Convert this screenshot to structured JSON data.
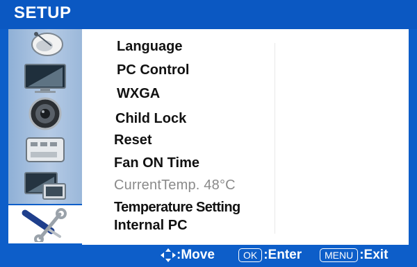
{
  "header": {
    "title": "SETUP"
  },
  "sidebar": {
    "icons": [
      {
        "name": "satellite-dish-icon"
      },
      {
        "name": "tv-screen-icon"
      },
      {
        "name": "speaker-icon"
      },
      {
        "name": "adapter-card-icon"
      },
      {
        "name": "pc-display-icon"
      },
      {
        "name": "setup-tools-icon"
      }
    ],
    "active_index": 5
  },
  "menu": {
    "items": [
      {
        "label": "Language"
      },
      {
        "label": "PC Control"
      },
      {
        "label": "WXGA"
      },
      {
        "label": "Child Lock"
      },
      {
        "label": "Reset"
      },
      {
        "label": "Fan ON Time"
      },
      {
        "label": "CurrentTemp. 48°C"
      },
      {
        "label": "Temperature Setting"
      },
      {
        "label": "Internal PC"
      }
    ]
  },
  "footer": {
    "move_label": ":Move",
    "ok_key": "OK",
    "enter_label": ":Enter",
    "menu_key": "MENU",
    "exit_label": ":Exit"
  },
  "colors": {
    "frame_blue": "#0d5ec9",
    "panel_white": "#ffffff",
    "disabled_text": "#8a8a8a"
  }
}
